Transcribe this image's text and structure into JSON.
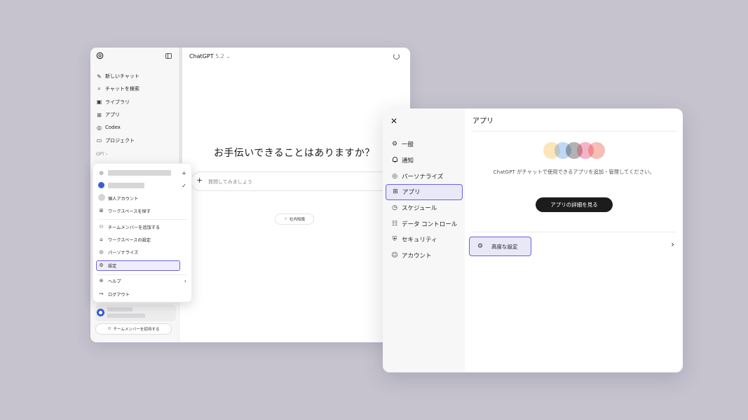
{
  "main_window": {
    "sidebar": {
      "items": [
        {
          "label": "新しいチャット",
          "icon": "new-chat-icon",
          "glyph": "✎"
        },
        {
          "label": "チャットを検索",
          "icon": "search-icon",
          "glyph": "⌕"
        },
        {
          "label": "ライブラリ",
          "icon": "library-icon",
          "glyph": "▣"
        },
        {
          "label": "アプリ",
          "icon": "apps-icon",
          "glyph": "⊞"
        },
        {
          "label": "Codex",
          "icon": "codex-icon",
          "glyph": "◎"
        },
        {
          "label": "プロジェクト",
          "icon": "folder-icon",
          "glyph": "▭"
        }
      ],
      "gpt_label": "GPT ›",
      "invite_label": "チームメンバーを招待する"
    },
    "header": {
      "model": "ChatGPT",
      "version": "5.2 ⌄"
    },
    "greeting": "お手伝いできることはありますか？",
    "composer": {
      "placeholder": "質問してみましょう"
    },
    "knowledge_chip": "社内知識"
  },
  "account_menu": {
    "personal_account": "個人アカウント",
    "find_workspace": "ワークスペースを探す",
    "items": [
      {
        "label": "チームメンバーを追加する",
        "icon": "add-member-icon",
        "glyph": "⚇"
      },
      {
        "label": "ワークスペースの設定",
        "icon": "workspace-settings-icon",
        "glyph": "⌂"
      },
      {
        "label": "パーソナライズ",
        "icon": "personalize-icon",
        "glyph": "◎"
      },
      {
        "label": "設定",
        "icon": "settings-icon",
        "glyph": "⚙"
      }
    ],
    "help": "ヘルプ",
    "logout": "ログアウト"
  },
  "settings_dialog": {
    "nav": [
      {
        "label": "一般",
        "icon": "gear-icon",
        "glyph": "⚙",
        "active": false
      },
      {
        "label": "通知",
        "icon": "bell-icon",
        "glyph": "♫",
        "active": false
      },
      {
        "label": "パーソナライズ",
        "icon": "personalize-icon",
        "glyph": "◎",
        "active": false
      },
      {
        "label": "アプリ",
        "icon": "apps-icon",
        "glyph": "⊞",
        "active": true
      },
      {
        "label": "スケジュール",
        "icon": "clock-icon",
        "glyph": "◷",
        "active": false
      },
      {
        "label": "データ コントロール",
        "icon": "database-icon",
        "glyph": "☷",
        "active": false
      },
      {
        "label": "セキュリティ",
        "icon": "shield-icon",
        "glyph": "⛨",
        "active": false
      },
      {
        "label": "アカウント",
        "icon": "account-icon",
        "glyph": "☺",
        "active": false
      }
    ],
    "title": "アプリ",
    "description": "ChatGPT がチャットで使用できるアプリを追加・管理してください。",
    "details_button": "アプリの詳細を見る",
    "advanced_label": "高度な設定"
  },
  "colors": {
    "accent": "#6c63d9",
    "background": "#c6c3cf"
  }
}
